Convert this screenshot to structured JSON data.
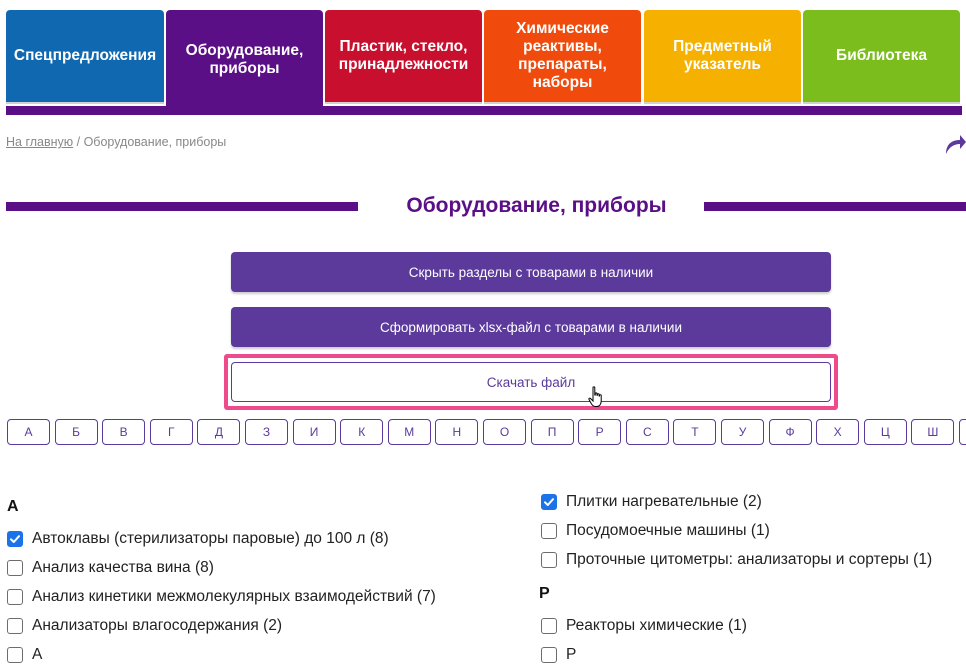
{
  "nav": {
    "tabs": [
      {
        "label": "Спецпредложения",
        "color": "#0f68b0",
        "active": false
      },
      {
        "label": "Оборудование, приборы",
        "color": "#5b0f86",
        "active": true
      },
      {
        "label": "Пластик, стекло, принадлежности",
        "color": "#c8102e",
        "active": false
      },
      {
        "label": "Химические реактивы, препараты, наборы",
        "color": "#f04b0c",
        "active": false
      },
      {
        "label": "Предметный указатель",
        "color": "#f5b000",
        "active": false
      },
      {
        "label": "Библиотека",
        "color": "#7bbd1c",
        "active": false
      }
    ]
  },
  "breadcrumb": {
    "home": "На главную",
    "separator": " / ",
    "current": "Оборудование, приборы"
  },
  "page": {
    "title": "Оборудование, приборы"
  },
  "actions": {
    "hide_sections": "Скрыть разделы с товарами в наличии",
    "make_xlsx": "Сформировать xlsx-файл с товарами в наличии",
    "download": "Скачать файл"
  },
  "alphabet": [
    "А",
    "Б",
    "В",
    "Г",
    "Д",
    "З",
    "И",
    "К",
    "М",
    "Н",
    "О",
    "П",
    "Р",
    "С",
    "Т",
    "У",
    "Ф",
    "Х",
    "Ц",
    "Ш"
  ],
  "left_column": {
    "heading": "А",
    "items": [
      {
        "label": "Автоклавы (стерилизаторы паровые) до 100 л (8)",
        "checked": true
      },
      {
        "label": "Анализ качества вина (8)",
        "checked": false
      },
      {
        "label": "Анализ кинетики межмолекулярных взаимодействий (7)",
        "checked": false
      },
      {
        "label": "Анализаторы влагосодержания (2)",
        "checked": false
      },
      {
        "label": "А",
        "checked": false
      }
    ]
  },
  "right_column": {
    "items_top": [
      {
        "label": "Плитки нагревательные (2)",
        "checked": true
      },
      {
        "label": "Посудомоечные машины (1)",
        "checked": false
      },
      {
        "label": "Проточные цитометры: анализаторы и сортеры (1)",
        "checked": false
      }
    ],
    "heading": "Р",
    "items_bottom": [
      {
        "label": "Реакторы химические (1)",
        "checked": false
      },
      {
        "label": "Р",
        "checked": false
      }
    ]
  },
  "icons": {
    "share": "share-arrow-icon",
    "check": "checkmark-icon",
    "cursor": "hand-pointer-icon"
  }
}
